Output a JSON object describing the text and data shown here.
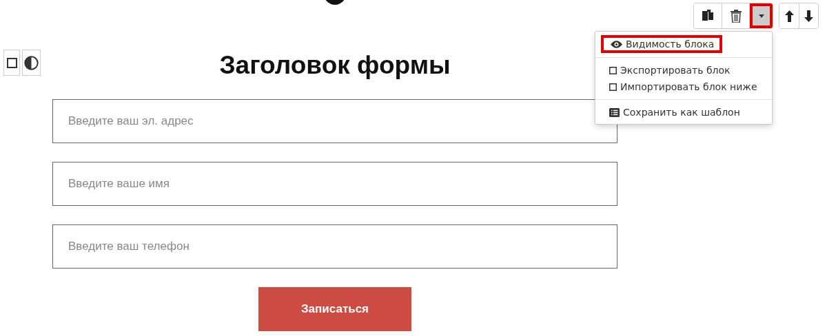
{
  "toolbar": {
    "buttons": [
      {
        "kind": "copy",
        "highlighted": false
      },
      {
        "kind": "delete",
        "highlighted": false
      },
      {
        "kind": "dropdown",
        "highlighted": true
      }
    ],
    "move_buttons": [
      {
        "kind": "up"
      },
      {
        "kind": "down"
      }
    ]
  },
  "dropdown_menu": {
    "groups": [
      [
        {
          "kind": "eye",
          "label": "Видимость блока",
          "highlighted": true
        }
      ],
      [
        {
          "kind": "square",
          "label": "Экспортировать блок",
          "highlighted": false
        },
        {
          "kind": "square",
          "label": "Импортировать блок ниже",
          "highlighted": false
        }
      ],
      [
        {
          "kind": "list",
          "label": "Сохранить как шаблон",
          "highlighted": false
        }
      ]
    ]
  },
  "side_tools": [
    {
      "kind": "square"
    },
    {
      "kind": "contrast"
    }
  ],
  "form": {
    "title": "Заголовок формы",
    "fields": [
      {
        "placeholder": "Введите ваш эл. адрес"
      },
      {
        "placeholder": "Введите ваше имя"
      },
      {
        "placeholder": "Введите ваш телефон"
      }
    ],
    "submit": "Записаться"
  }
}
